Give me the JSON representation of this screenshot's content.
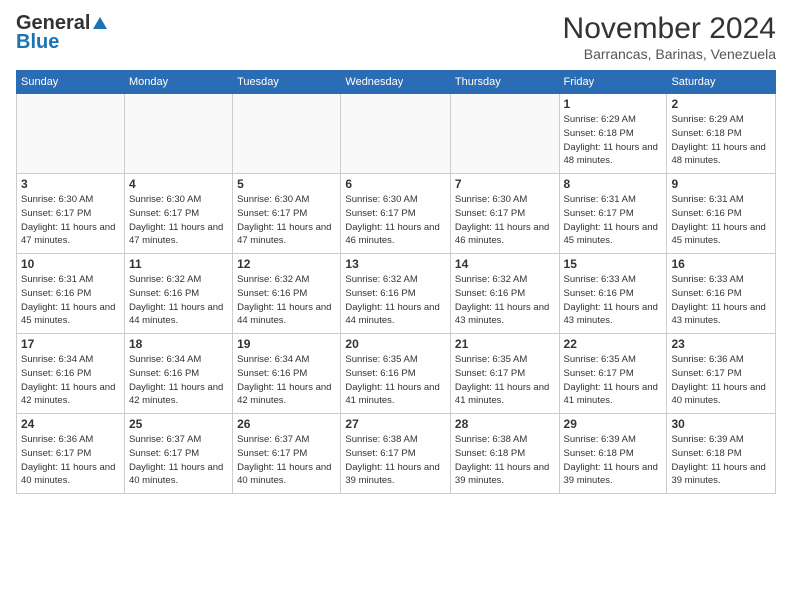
{
  "header": {
    "logo_general": "General",
    "logo_blue": "Blue",
    "month_title": "November 2024",
    "location": "Barrancas, Barinas, Venezuela"
  },
  "days_of_week": [
    "Sunday",
    "Monday",
    "Tuesday",
    "Wednesday",
    "Thursday",
    "Friday",
    "Saturday"
  ],
  "weeks": [
    [
      {
        "day": "",
        "info": ""
      },
      {
        "day": "",
        "info": ""
      },
      {
        "day": "",
        "info": ""
      },
      {
        "day": "",
        "info": ""
      },
      {
        "day": "",
        "info": ""
      },
      {
        "day": "1",
        "info": "Sunrise: 6:29 AM\nSunset: 6:18 PM\nDaylight: 11 hours\nand 48 minutes."
      },
      {
        "day": "2",
        "info": "Sunrise: 6:29 AM\nSunset: 6:18 PM\nDaylight: 11 hours\nand 48 minutes."
      }
    ],
    [
      {
        "day": "3",
        "info": "Sunrise: 6:30 AM\nSunset: 6:17 PM\nDaylight: 11 hours\nand 47 minutes."
      },
      {
        "day": "4",
        "info": "Sunrise: 6:30 AM\nSunset: 6:17 PM\nDaylight: 11 hours\nand 47 minutes."
      },
      {
        "day": "5",
        "info": "Sunrise: 6:30 AM\nSunset: 6:17 PM\nDaylight: 11 hours\nand 47 minutes."
      },
      {
        "day": "6",
        "info": "Sunrise: 6:30 AM\nSunset: 6:17 PM\nDaylight: 11 hours\nand 46 minutes."
      },
      {
        "day": "7",
        "info": "Sunrise: 6:30 AM\nSunset: 6:17 PM\nDaylight: 11 hours\nand 46 minutes."
      },
      {
        "day": "8",
        "info": "Sunrise: 6:31 AM\nSunset: 6:17 PM\nDaylight: 11 hours\nand 45 minutes."
      },
      {
        "day": "9",
        "info": "Sunrise: 6:31 AM\nSunset: 6:16 PM\nDaylight: 11 hours\nand 45 minutes."
      }
    ],
    [
      {
        "day": "10",
        "info": "Sunrise: 6:31 AM\nSunset: 6:16 PM\nDaylight: 11 hours\nand 45 minutes."
      },
      {
        "day": "11",
        "info": "Sunrise: 6:32 AM\nSunset: 6:16 PM\nDaylight: 11 hours\nand 44 minutes."
      },
      {
        "day": "12",
        "info": "Sunrise: 6:32 AM\nSunset: 6:16 PM\nDaylight: 11 hours\nand 44 minutes."
      },
      {
        "day": "13",
        "info": "Sunrise: 6:32 AM\nSunset: 6:16 PM\nDaylight: 11 hours\nand 44 minutes."
      },
      {
        "day": "14",
        "info": "Sunrise: 6:32 AM\nSunset: 6:16 PM\nDaylight: 11 hours\nand 43 minutes."
      },
      {
        "day": "15",
        "info": "Sunrise: 6:33 AM\nSunset: 6:16 PM\nDaylight: 11 hours\nand 43 minutes."
      },
      {
        "day": "16",
        "info": "Sunrise: 6:33 AM\nSunset: 6:16 PM\nDaylight: 11 hours\nand 43 minutes."
      }
    ],
    [
      {
        "day": "17",
        "info": "Sunrise: 6:34 AM\nSunset: 6:16 PM\nDaylight: 11 hours\nand 42 minutes."
      },
      {
        "day": "18",
        "info": "Sunrise: 6:34 AM\nSunset: 6:16 PM\nDaylight: 11 hours\nand 42 minutes."
      },
      {
        "day": "19",
        "info": "Sunrise: 6:34 AM\nSunset: 6:16 PM\nDaylight: 11 hours\nand 42 minutes."
      },
      {
        "day": "20",
        "info": "Sunrise: 6:35 AM\nSunset: 6:16 PM\nDaylight: 11 hours\nand 41 minutes."
      },
      {
        "day": "21",
        "info": "Sunrise: 6:35 AM\nSunset: 6:17 PM\nDaylight: 11 hours\nand 41 minutes."
      },
      {
        "day": "22",
        "info": "Sunrise: 6:35 AM\nSunset: 6:17 PM\nDaylight: 11 hours\nand 41 minutes."
      },
      {
        "day": "23",
        "info": "Sunrise: 6:36 AM\nSunset: 6:17 PM\nDaylight: 11 hours\nand 40 minutes."
      }
    ],
    [
      {
        "day": "24",
        "info": "Sunrise: 6:36 AM\nSunset: 6:17 PM\nDaylight: 11 hours\nand 40 minutes."
      },
      {
        "day": "25",
        "info": "Sunrise: 6:37 AM\nSunset: 6:17 PM\nDaylight: 11 hours\nand 40 minutes."
      },
      {
        "day": "26",
        "info": "Sunrise: 6:37 AM\nSunset: 6:17 PM\nDaylight: 11 hours\nand 40 minutes."
      },
      {
        "day": "27",
        "info": "Sunrise: 6:38 AM\nSunset: 6:17 PM\nDaylight: 11 hours\nand 39 minutes."
      },
      {
        "day": "28",
        "info": "Sunrise: 6:38 AM\nSunset: 6:18 PM\nDaylight: 11 hours\nand 39 minutes."
      },
      {
        "day": "29",
        "info": "Sunrise: 6:39 AM\nSunset: 6:18 PM\nDaylight: 11 hours\nand 39 minutes."
      },
      {
        "day": "30",
        "info": "Sunrise: 6:39 AM\nSunset: 6:18 PM\nDaylight: 11 hours\nand 39 minutes."
      }
    ]
  ]
}
